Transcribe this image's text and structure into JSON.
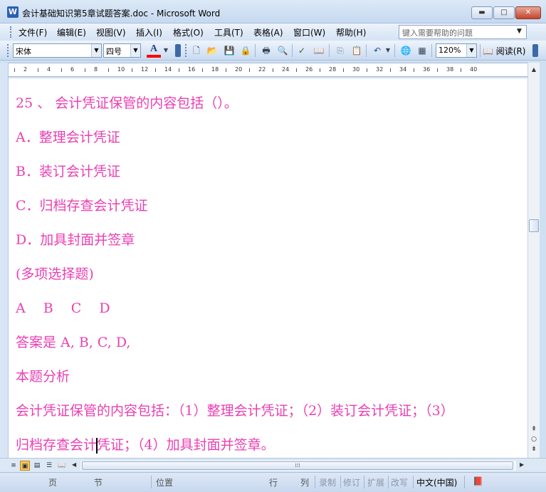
{
  "window": {
    "title": "会计基础知识第5章试题答案.doc - Microsoft Word",
    "app_icon": "W",
    "minimize": "▬",
    "maximize": "□",
    "close": "✕"
  },
  "menu": {
    "items": [
      "文件(F)",
      "编辑(E)",
      "视图(V)",
      "插入(I)",
      "格式(O)",
      "工具(T)",
      "表格(A)",
      "窗口(W)",
      "帮助(H)"
    ],
    "help_placeholder": "键入需要帮助的问题"
  },
  "toolbar": {
    "font_name": "宋体",
    "font_size": "四号",
    "font_color_label": "A",
    "zoom": "120%",
    "read_label": "阅读(R)",
    "icons": [
      "new-document-icon",
      "open-folder-icon",
      "save-icon",
      "permission-icon",
      "print-icon",
      "print-preview-icon",
      "spelling-icon",
      "research-icon",
      "copy-icon",
      "paste-icon",
      "undo-icon",
      "hyperlink-icon",
      "table-icon"
    ]
  },
  "ruler": {
    "numbers": [
      "2",
      "4",
      "6",
      "8",
      "10",
      "12",
      "14",
      "16",
      "18",
      "20",
      "22",
      "24",
      "26",
      "28",
      "30",
      "32",
      "34",
      "36",
      "38",
      "40"
    ]
  },
  "document": {
    "paragraphs": [
      "25 、 会计凭证保管的内容包括（）。",
      "A．整理会计凭证",
      "B．装订会计凭证",
      "C．归档存查会计凭证",
      "D．加具封面并签章",
      "(多项选择题)",
      "A　 B　 C　 D",
      "答案是 A, B, C, D,",
      "本题分析",
      "会计凭证保管的内容包括：（1）整理会计凭证；（2）装订会计凭证；（3）"
    ],
    "last_line_before_caret": "归档存查会计",
    "last_line_after_caret": "凭证；（4）加具封面并签章。",
    "text_color": "#ea3fb2"
  },
  "statusbar": {
    "page": "页",
    "section": "节",
    "position": "位置",
    "line": "行",
    "column": "列",
    "rec": "录制",
    "trk": "修订",
    "ext": "扩展",
    "ovr": "改写",
    "language": "中文(中国)"
  }
}
